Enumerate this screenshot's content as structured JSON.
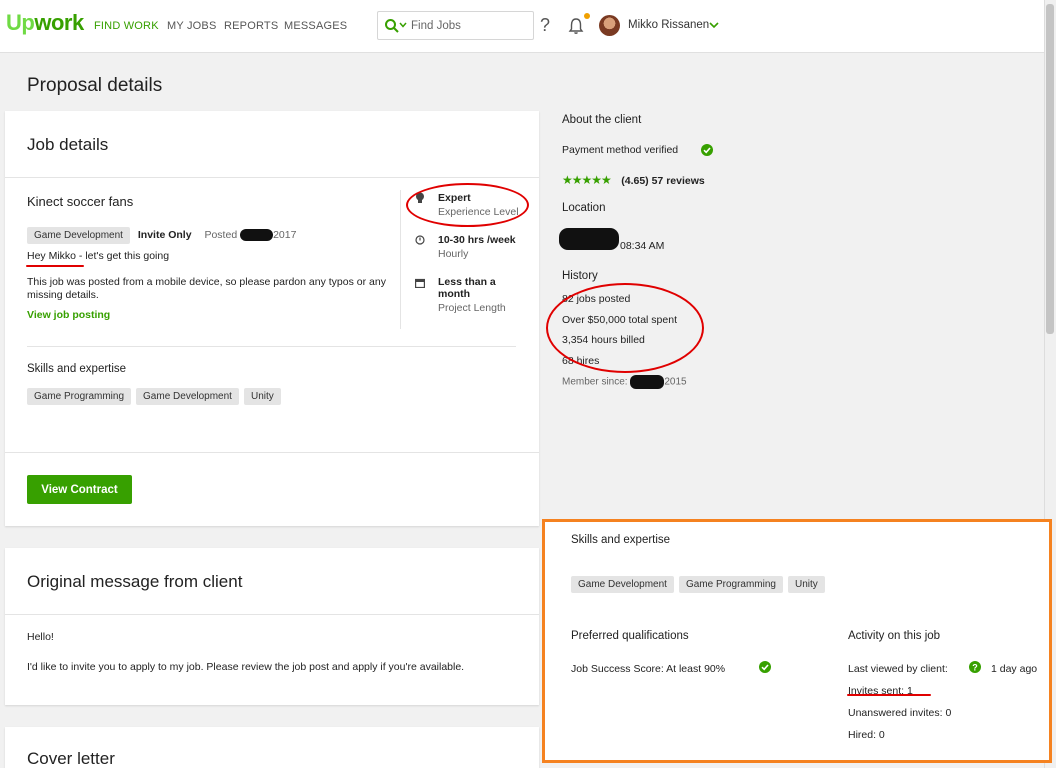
{
  "nav": {
    "logo_up": "Up",
    "logo_work": "work",
    "items": [
      "FIND WORK",
      "MY JOBS",
      "REPORTS",
      "MESSAGES"
    ],
    "search_placeholder": "Find Jobs",
    "help": "?",
    "user_name": "Mikko Rissanen"
  },
  "page": {
    "title": "Proposal details"
  },
  "job": {
    "section_title": "Job details",
    "name": "Kinect soccer fans",
    "category": "Game Development",
    "invite": "Invite Only",
    "posted_label": "Posted",
    "posted_year": "2017",
    "greeting_underlined": "Hey Mikko",
    "greeting_rest": " - let's get this going",
    "note": "This job was posted from a mobile device, so please pardon any typos or any missing details.",
    "view_link": "View job posting",
    "level": "Expert",
    "level_label": "Experience Level",
    "hours": "10-30 hrs /week",
    "hours_label": "Hourly",
    "duration": "Less than a month",
    "duration_label": "Project Length",
    "skills_title": "Skills and expertise",
    "skills": [
      "Game Programming",
      "Game Development",
      "Unity"
    ],
    "contract_button": "View Contract"
  },
  "message": {
    "title": "Original message from client",
    "greeting": "Hello!",
    "body": "I'd like to invite you to apply to my job. Please review the job post and apply if you're available."
  },
  "cover": {
    "title": "Cover letter"
  },
  "client": {
    "about_title": "About the client",
    "payment": "Payment method verified",
    "rating": "(4.65) 57 reviews",
    "rating_value": 4.65,
    "location_title": "Location",
    "local_time": "08:34 AM",
    "history_title": "History",
    "jobs_posted": "82 jobs posted",
    "total_spent": "Over $50,000 total spent",
    "hours_billed": "3,354 hours billed",
    "hires": "68 hires",
    "member_label": "Member since:",
    "member_year": "2015"
  },
  "panel": {
    "skills_title": "Skills and expertise",
    "skills": [
      "Game Development",
      "Game Programming",
      "Unity"
    ],
    "qual_title": "Preferred qualifications",
    "qual_jss": "Job Success Score: At least 90%",
    "activity_title": "Activity on this job",
    "last_viewed": "Last viewed by client:",
    "last_viewed_value": "1 day ago",
    "invites_sent": "Invites sent: 1",
    "unanswered": "Unanswered invites: 0",
    "hired": "Hired: 0"
  },
  "colors": {
    "brand_green": "#37a000",
    "annotation_red": "#e00000",
    "annotation_orange": "#f58220"
  }
}
